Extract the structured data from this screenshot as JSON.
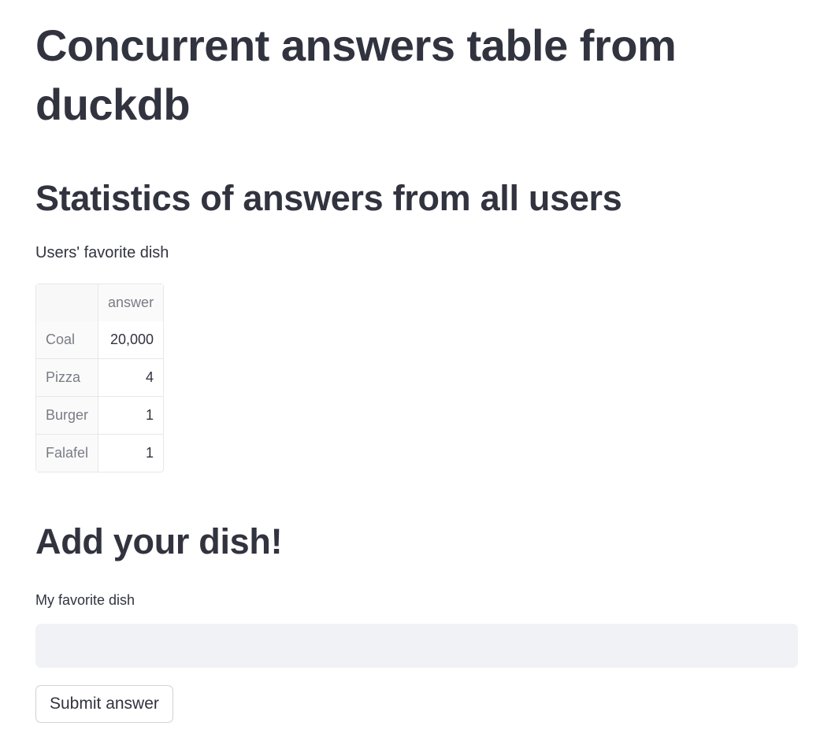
{
  "page": {
    "title": "Concurrent answers table from duckdb"
  },
  "stats": {
    "heading": "Statistics of answers from all users",
    "caption": "Users' favorite dish",
    "table": {
      "columns": [
        "",
        "answer"
      ],
      "rows": [
        {
          "index": "Coal",
          "answer": "20,000"
        },
        {
          "index": "Pizza",
          "answer": "4"
        },
        {
          "index": "Burger",
          "answer": "1"
        },
        {
          "index": "Falafel",
          "answer": "1"
        }
      ]
    }
  },
  "form": {
    "heading": "Add your dish!",
    "input_label": "My favorite dish",
    "input_value": "",
    "input_placeholder": "",
    "submit_label": "Submit answer"
  }
}
